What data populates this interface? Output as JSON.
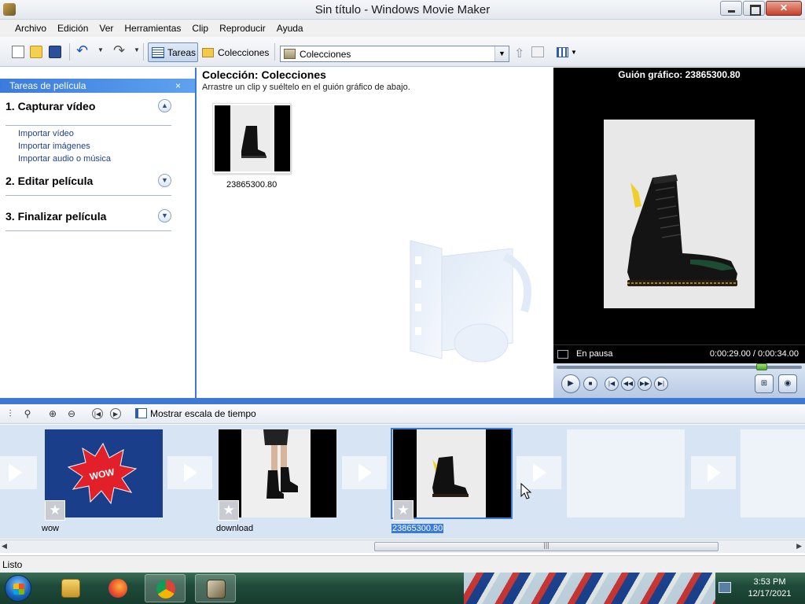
{
  "window": {
    "title": "Sin título - Windows Movie Maker"
  },
  "menu": [
    "Archivo",
    "Edición",
    "Ver",
    "Herramientas",
    "Clip",
    "Reproducir",
    "Ayuda"
  ],
  "toolbar": {
    "tareas_label": "Tareas",
    "colecciones_label": "Colecciones",
    "collection_select_value": "Colecciones"
  },
  "taskpane": {
    "header": "Tareas de película",
    "sections": [
      {
        "title": "1. Capturar vídeo",
        "expanded": true,
        "links": [
          "Importar vídeo",
          "Importar imágenes",
          "Importar audio o música"
        ]
      },
      {
        "title": "2. Editar película",
        "expanded": false
      },
      {
        "title": "3. Finalizar película",
        "expanded": false
      }
    ]
  },
  "collection": {
    "title": "Colección: Colecciones",
    "subtitle": "Arrastre un clip y suéltelo en el guión gráfico de abajo.",
    "clips": [
      {
        "label": "23865300.80"
      }
    ]
  },
  "preview": {
    "title": "Guión gráfico: 23865300.80",
    "state": "En pausa",
    "time": "0:00:29.00 / 0:00:34.00",
    "seek_fraction": 0.853
  },
  "storyboard_toolbar": {
    "timeline_label": "Mostrar escala de tiempo"
  },
  "storyboard": {
    "clips": [
      {
        "label": "wow",
        "selected": false,
        "kind": "wow"
      },
      {
        "label": "download",
        "selected": false,
        "kind": "legs"
      },
      {
        "label": "23865300.80",
        "selected": true,
        "kind": "boot"
      }
    ]
  },
  "status": {
    "text": "Listo"
  },
  "taskbar": {
    "time": "3:53 PM",
    "date": "12/17/2021"
  },
  "colors": {
    "accent": "#3f78d3",
    "storyboard_bg": "#d6e4f3",
    "wow_bg": "#1a3e8a",
    "wow_burst": "#e2202a"
  }
}
